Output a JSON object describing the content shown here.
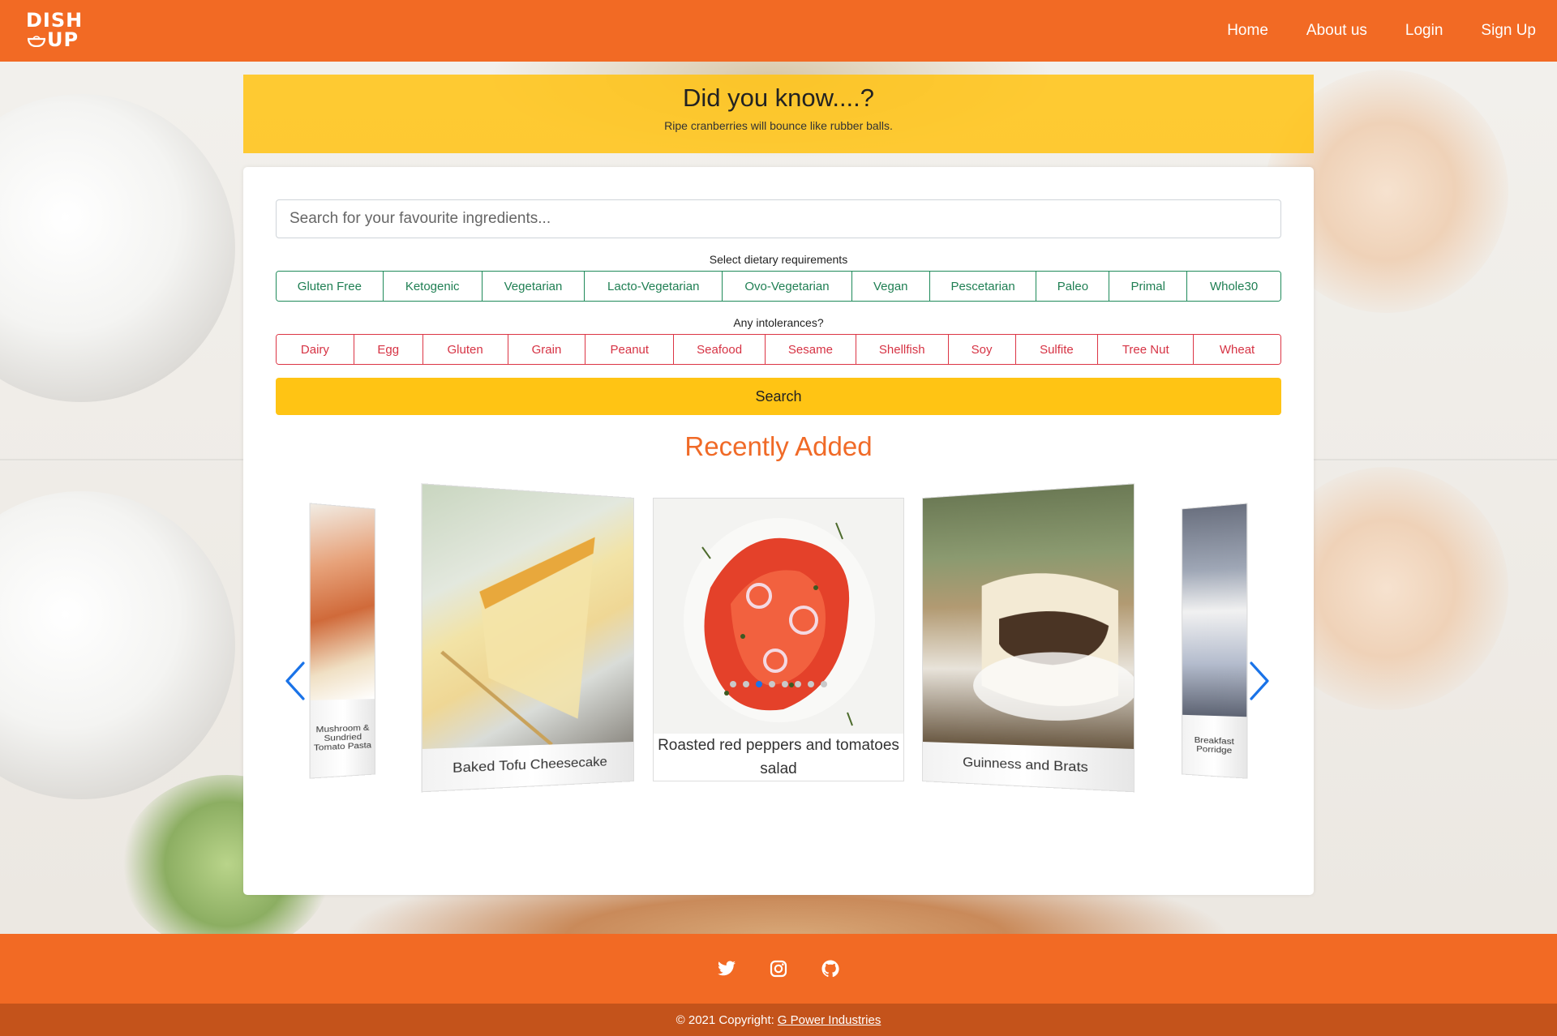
{
  "brand": {
    "logo_line1": "DISH",
    "logo_line2": "UP",
    "color_primary": "#f26a24",
    "color_accent": "#ffc414"
  },
  "nav": {
    "items": [
      "Home",
      "About us",
      "Login",
      "Sign Up"
    ]
  },
  "fact": {
    "title": "Did you know....?",
    "text": "Ripe cranberries will bounce like rubber balls."
  },
  "search": {
    "placeholder": "Search for your favourite ingredients...",
    "button_label": "Search"
  },
  "diet": {
    "label": "Select dietary requirements",
    "options": [
      "Gluten Free",
      "Ketogenic",
      "Vegetarian",
      "Lacto-Vegetarian",
      "Ovo-Vegetarian",
      "Vegan",
      "Pescetarian",
      "Paleo",
      "Primal",
      "Whole30"
    ]
  },
  "intolerances": {
    "label": "Any intolerances?",
    "options": [
      "Dairy",
      "Egg",
      "Gluten",
      "Grain",
      "Peanut",
      "Seafood",
      "Sesame",
      "Shellfish",
      "Soy",
      "Sulfite",
      "Tree Nut",
      "Wheat"
    ]
  },
  "recent": {
    "title": "Recently Added",
    "slides": [
      "Mushroom & Sundried Tomato Pasta",
      "Baked Tofu Cheesecake",
      "Roasted red peppers and tomatoes salad",
      "Guinness and Brats",
      "Breakfast Porridge"
    ],
    "dot_count": 8,
    "active_dot": 3
  },
  "footer": {
    "social": [
      "twitter-icon",
      "instagram-icon",
      "github-icon"
    ],
    "copyright_prefix": "© 2021 Copyright:",
    "copyright_link": "G Power Industries"
  }
}
